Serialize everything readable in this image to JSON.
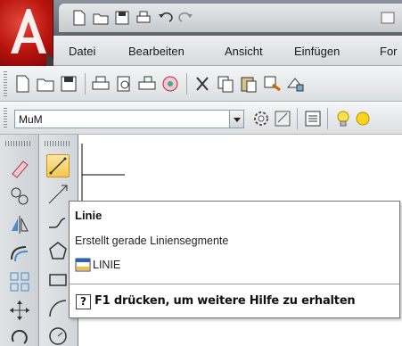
{
  "menu": {
    "items": [
      {
        "label": "Datei"
      },
      {
        "label": "Bearbeiten"
      },
      {
        "label": "Ansicht"
      },
      {
        "label": "Einfügen"
      },
      {
        "label": "For"
      }
    ]
  },
  "toolbar2": {
    "style_selector": {
      "value": "MuM"
    }
  },
  "tooltip": {
    "title": "Linie",
    "description": "Erstellt gerade Liniensegmente",
    "command": "LINIE",
    "help_symbol": "?",
    "help_text": "F1 drücken, um weitere Hilfe zu erhalten"
  },
  "colors": {
    "app_logo": "#b8130d",
    "active_tool": "#f6c64c"
  }
}
